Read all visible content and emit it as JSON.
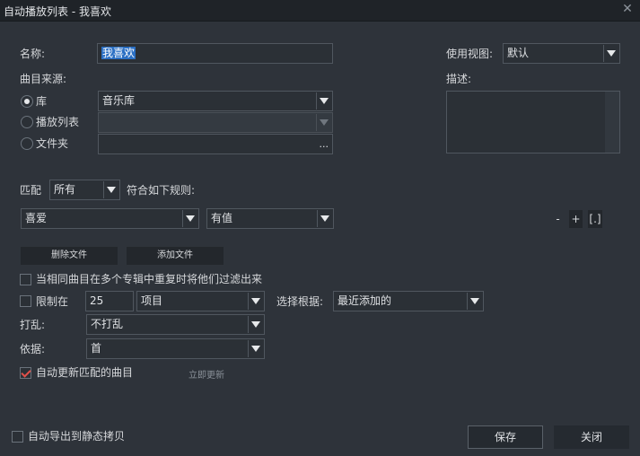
{
  "window": {
    "title": "自动播放列表 - 我喜欢",
    "close_glyph": "✕"
  },
  "name_field": {
    "label": "名称:",
    "value": "我喜欢"
  },
  "view": {
    "label": "使用视图:",
    "value": "默认"
  },
  "source": {
    "label": "曲目来源:",
    "library": {
      "label": "库",
      "selected": true,
      "value": "音乐库"
    },
    "playlist": {
      "label": "播放列表",
      "selected": false,
      "value": ""
    },
    "folder": {
      "label": "文件夹",
      "selected": false,
      "value": "",
      "browse": "..."
    }
  },
  "description": {
    "label": "描述:",
    "value": ""
  },
  "match": {
    "label": "匹配",
    "value": "所有",
    "suffix": "符合如下规则:"
  },
  "rule": {
    "field": "喜爱",
    "condition": "有值",
    "minus": "-",
    "plus": "+",
    "bracket": "[.]"
  },
  "buttons": {
    "delete_files": "删除文件",
    "add_files": "添加文件",
    "save": "保存",
    "close": "关闭"
  },
  "dedupe": {
    "label": "当相同曲目在多个专辑中重复时将他们过滤出来",
    "checked": false
  },
  "limit": {
    "label": "限制在",
    "checked": false,
    "count": "25",
    "unit": "项目",
    "select_by_label": "选择根据:",
    "select_by_value": "最近添加的"
  },
  "shuffle": {
    "label": "打乱:",
    "value": "不打乱"
  },
  "basis": {
    "label": "依据:",
    "value": "首"
  },
  "auto_update": {
    "label": "自动更新匹配的曲目",
    "checked": true,
    "update_now": "立即更新"
  },
  "auto_export": {
    "label": "自动导出到静态拷贝",
    "checked": false
  },
  "colors": {
    "background": "#2e333a",
    "titlebar": "#1f2328",
    "selection": "#2a6fc4",
    "check": "#e2504a"
  }
}
